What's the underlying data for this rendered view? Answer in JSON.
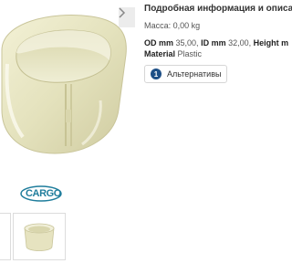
{
  "details": {
    "title": "Подробная информация и описан",
    "mass_label": "Масса:",
    "mass_value": "0,00 kg",
    "specs": [
      {
        "label": "OD mm",
        "value": "35,00,"
      },
      {
        "label": "ID mm",
        "value": "32,00,"
      },
      {
        "label": "Height m",
        "value": ""
      }
    ],
    "material_label": "Material",
    "material_value": "Plastic"
  },
  "alternatives": {
    "count": "1",
    "label": "Альтернативы"
  },
  "brand": {
    "logo_text": "CARGO"
  },
  "colors": {
    "brand_teal": "#1f7d9c",
    "badge_blue": "#1d4f86"
  }
}
